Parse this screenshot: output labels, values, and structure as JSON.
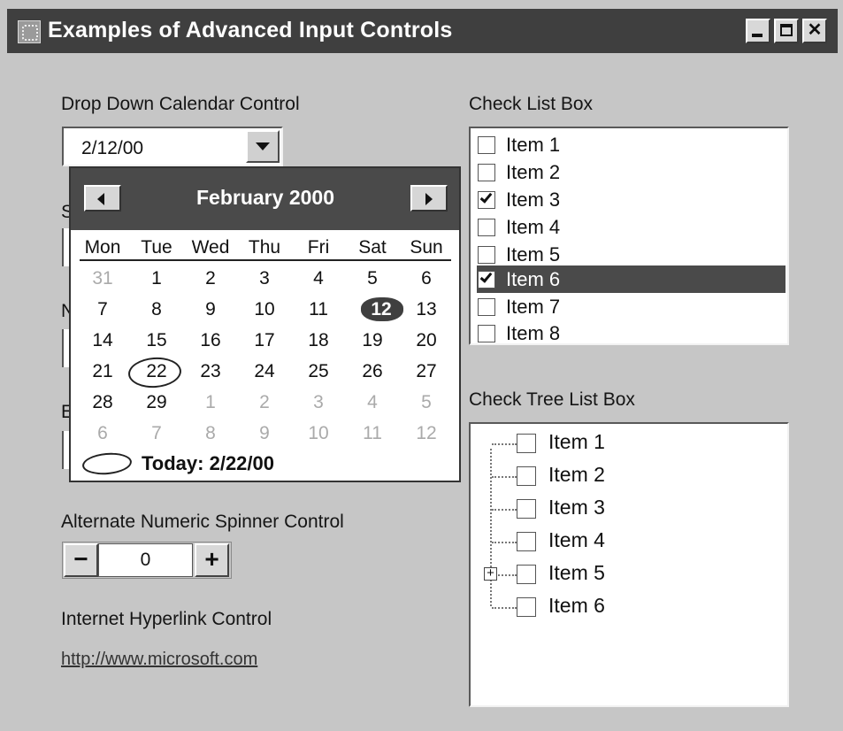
{
  "window": {
    "title": "Examples of Advanced Input Controls",
    "controls": {
      "minimize": "minimize",
      "maximize": "maximize",
      "close": "✕"
    }
  },
  "drop_down_calendar": {
    "label": "Drop Down Calendar Control",
    "value": "2/12/00",
    "calendar": {
      "month_label": "February 2000",
      "weekdays": [
        "Mon",
        "Tue",
        "Wed",
        "Thu",
        "Fri",
        "Sat",
        "Sun"
      ],
      "weeks": [
        [
          "31",
          "1",
          "2",
          "3",
          "4",
          "5",
          "6"
        ],
        [
          "7",
          "8",
          "9",
          "10",
          "11",
          "12",
          "13"
        ],
        [
          "14",
          "15",
          "16",
          "17",
          "18",
          "19",
          "20"
        ],
        [
          "21",
          "22",
          "23",
          "24",
          "25",
          "26",
          "27"
        ],
        [
          "28",
          "29",
          "1",
          "2",
          "3",
          "4",
          "5"
        ],
        [
          "6",
          "7",
          "8",
          "9",
          "10",
          "11",
          "12"
        ]
      ],
      "today_label": "Today: 2/22/00"
    }
  },
  "obscured_labels": [
    {
      "text": "S"
    },
    {
      "text": "N"
    },
    {
      "text": "E"
    }
  ],
  "spinner": {
    "label": "Alternate Numeric Spinner Control",
    "value": "0",
    "minus": "−",
    "plus": "+"
  },
  "hyperlink": {
    "label": "Internet Hyperlink Control",
    "url": "http://www.microsoft.com"
  },
  "check_list": {
    "label": "Check List Box",
    "items": [
      {
        "label": "Item 1",
        "checked": false
      },
      {
        "label": "Item 2",
        "checked": false
      },
      {
        "label": "Item 3",
        "checked": true
      },
      {
        "label": "Item 4",
        "checked": false
      },
      {
        "label": "Item 5",
        "checked": false
      },
      {
        "label": "Item 6",
        "checked": true
      },
      {
        "label": "Item 7",
        "checked": false
      },
      {
        "label": "Item 8",
        "checked": false
      }
    ]
  },
  "check_tree": {
    "label": "Check Tree List Box",
    "items": [
      {
        "label": "Item 1"
      },
      {
        "label": "Item 2"
      },
      {
        "label": "Item 3"
      },
      {
        "label": "Item 4"
      },
      {
        "label": "Item 5"
      },
      {
        "label": "Item 6"
      }
    ],
    "expander_symbol": "+"
  }
}
